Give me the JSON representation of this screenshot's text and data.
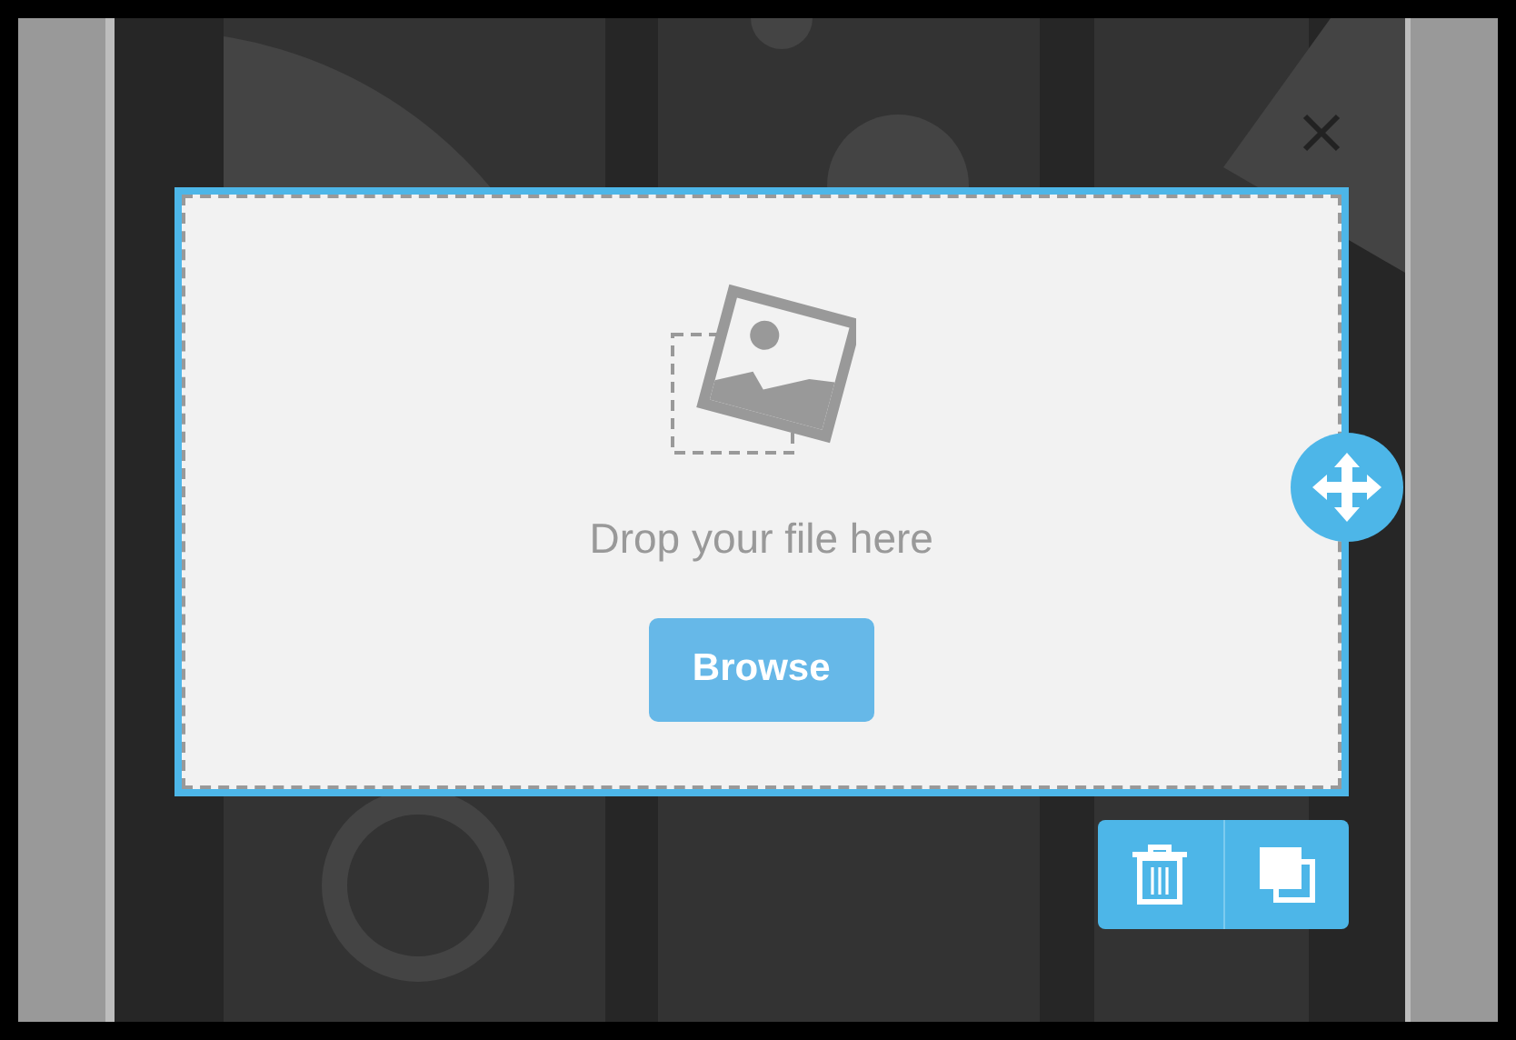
{
  "dropzone": {
    "selected": true,
    "message": "Drop your file here",
    "button": "Browse"
  },
  "toolbar": {
    "buttons": [
      {
        "kind": "delete"
      },
      {
        "kind": "duplicate"
      }
    ]
  }
}
